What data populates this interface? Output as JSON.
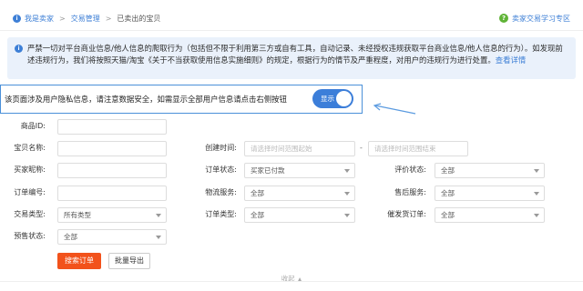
{
  "breadcrumb": {
    "items": [
      "我是卖家",
      "交易管理",
      "已卖出的宝贝"
    ],
    "separator": ">"
  },
  "help_link": "卖家交易学习专区",
  "notice": {
    "text": "严禁一切对平台商业信息/他人信息的爬取行为（包括但不限于利用第三方或自有工具，自动记录、未经授权违规获取平台商业信息/他人信息的行为）。如发现前述违规行为，我们将按照天猫/淘宝《关于不当获取使用信息实施细则》的规定，根据行为的情节及严重程度，对用户的违规行为进行处置。",
    "more": "查看详情"
  },
  "privacy": {
    "text": "该页面涉及用户隐私信息，请注意数据安全，如需显示全部用户信息请点击右侧按钮",
    "toggle_label": "显示",
    "toggle_on": true
  },
  "form": {
    "item_id": {
      "label": "商品ID:",
      "value": ""
    },
    "item_name": {
      "label": "宝贝名称:",
      "value": ""
    },
    "created_time": {
      "label": "创建时间:",
      "start_placeholder": "请选择时间范围起始",
      "end_placeholder": "请选择时间范围结束",
      "separator": "-"
    },
    "buyer_nick": {
      "label": "买家昵称:",
      "value": ""
    },
    "order_status": {
      "label": "订单状态:",
      "value": "买家已付款"
    },
    "review_status": {
      "label": "评价状态:",
      "value": "全部"
    },
    "order_no": {
      "label": "订单编号:",
      "value": ""
    },
    "logistics": {
      "label": "物流服务:",
      "value": "全部"
    },
    "after_sale": {
      "label": "售后服务:",
      "value": "全部"
    },
    "trade_type": {
      "label": "交易类型:",
      "value": "所有类型"
    },
    "order_type": {
      "label": "订单类型:",
      "value": "全部"
    },
    "urge_order": {
      "label": "催发货订单:",
      "value": "全部"
    },
    "presale_status": {
      "label": "预售状态:",
      "value": "全部"
    }
  },
  "buttons": {
    "search": "搜索订单",
    "export": "批量导出"
  },
  "collapse_label": "收起",
  "colors": {
    "accent": "#3d7fd6",
    "primary_button": "#f2521b",
    "notice_bg": "#eaf1fb"
  }
}
